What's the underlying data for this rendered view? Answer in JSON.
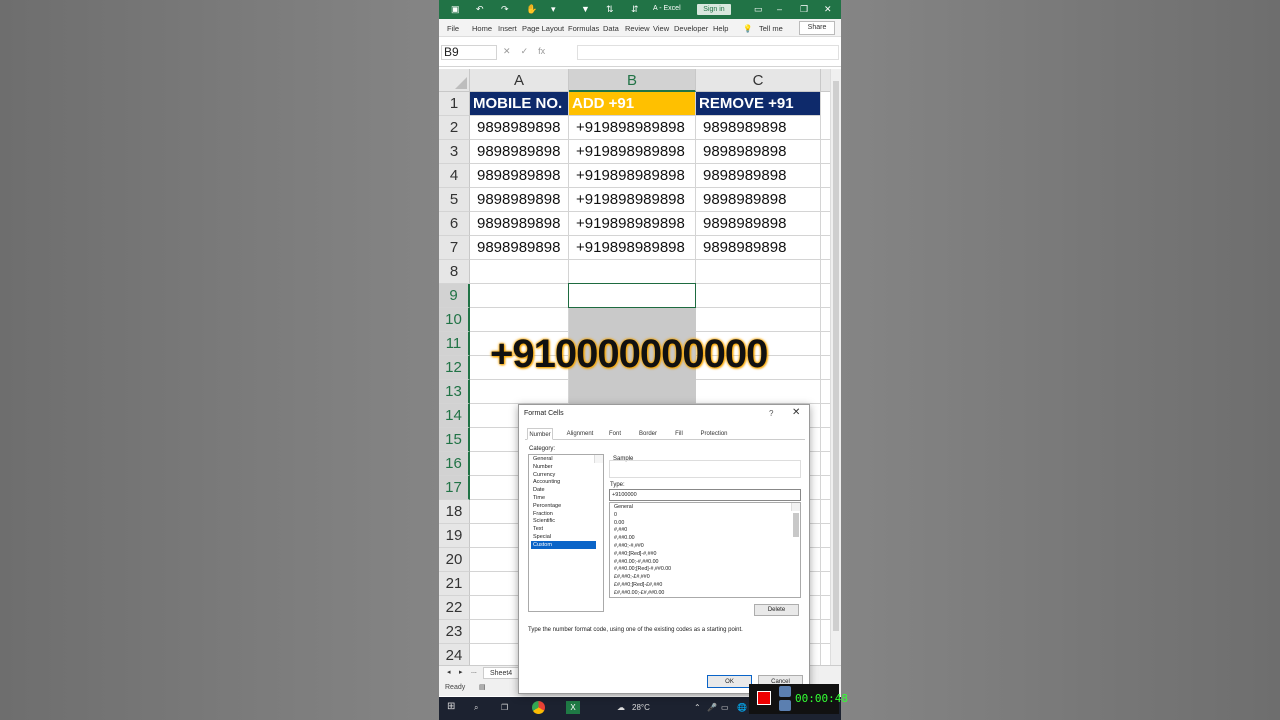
{
  "titlebar": {
    "title": "A - Excel",
    "signin": "Sign in"
  },
  "ribbon": {
    "tabs": [
      "File",
      "Home",
      "Insert",
      "Page Layout",
      "Formulas",
      "Data",
      "Review",
      "View",
      "Developer",
      "Help"
    ],
    "tell_me": "Tell me",
    "share": "Share"
  },
  "formula_bar": {
    "name_box": "B9",
    "fx": "fx",
    "value": ""
  },
  "columns": [
    "A",
    "B",
    "C"
  ],
  "rows": [
    "1",
    "2",
    "3",
    "4",
    "5",
    "6",
    "7",
    "8",
    "9",
    "10",
    "11",
    "12",
    "13",
    "14",
    "15",
    "16",
    "17",
    "18",
    "19",
    "20",
    "21",
    "22",
    "23",
    "24"
  ],
  "table": {
    "headers": [
      "MOBILE NO.",
      "ADD +91",
      "REMOVE +91"
    ],
    "data": [
      [
        "9898989898",
        "+919898989898",
        "9898989898"
      ],
      [
        "9898989898",
        "+919898989898",
        "9898989898"
      ],
      [
        "9898989898",
        "+919898989898",
        "9898989898"
      ],
      [
        "9898989898",
        "+919898989898",
        "9898989898"
      ],
      [
        "9898989898",
        "+919898989898",
        "9898989898"
      ],
      [
        "9898989898",
        "+919898989898",
        "9898989898"
      ]
    ]
  },
  "overlay_text": "+910000000000",
  "sheet": {
    "tab": "Sheet4",
    "ellipsis": "...",
    "status": "Ready"
  },
  "dialog": {
    "title": "Format Cells",
    "help": "?",
    "close": "✕",
    "tabs": [
      "Number",
      "Alignment",
      "Font",
      "Border",
      "Fill",
      "Protection"
    ],
    "category_label": "Category:",
    "categories": [
      "General",
      "Number",
      "Currency",
      "Accounting",
      "Date",
      "Time",
      "Percentage",
      "Fraction",
      "Scientific",
      "Text",
      "Special",
      "Custom"
    ],
    "selected_category": "Custom",
    "sample_label": "Sample",
    "type_label": "Type:",
    "type_value": "+9100000",
    "formats": [
      "General",
      "0",
      "0.00",
      "#,##0",
      "#,##0.00",
      "#,##0;-#,##0",
      "#,##0;[Red]-#,##0",
      "#,##0.00;-#,##0.00",
      "#,##0.00;[Red]-#,##0.00",
      "£#,##0;-£#,##0",
      "£#,##0;[Red]-£#,##0",
      "£#,##0.00;-£#,##0.00"
    ],
    "delete": "Delete",
    "hint": "Type the number format code, using one of the existing codes as a starting point.",
    "ok": "OK",
    "cancel": "Cancel"
  },
  "taskbar": {
    "temperature": "28°C"
  },
  "recorder": {
    "timer": "00:00:48"
  }
}
